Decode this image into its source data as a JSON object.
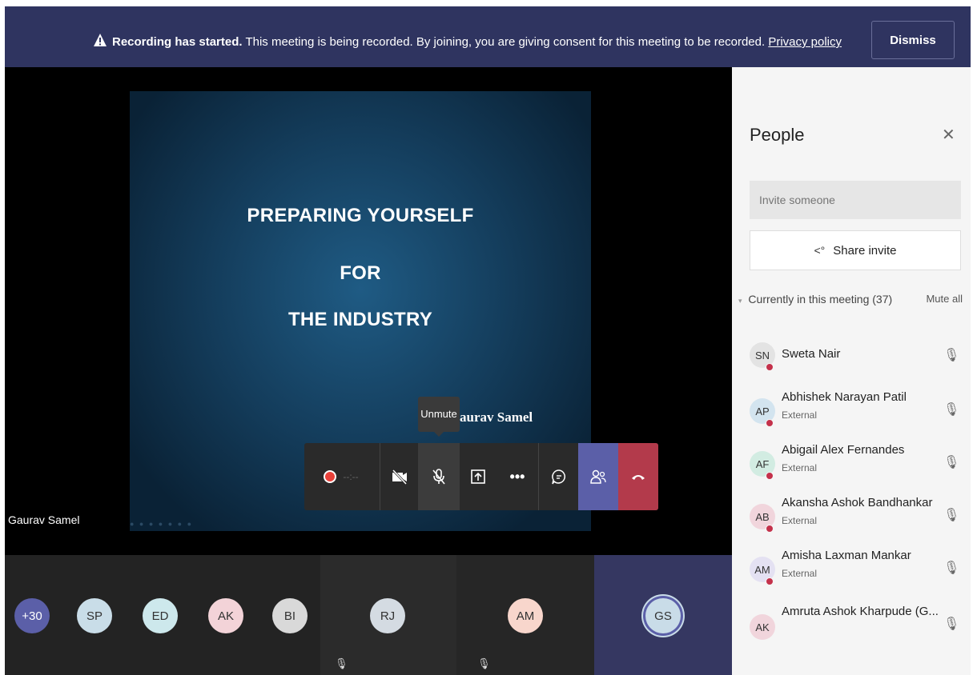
{
  "banner": {
    "title": "Recording has started.",
    "message": " This meeting is being recorded. By joining, you are giving consent for this meeting to be recorded. ",
    "link": "Privacy policy",
    "dismiss_label": "Dismiss"
  },
  "slide": {
    "line1": "PREPARING YOURSELF",
    "line2": "FOR",
    "line3": "THE INDUSTRY",
    "author": "aurav Samel"
  },
  "presenter_name": "Gaurav Samel",
  "tooltip": "Unmute",
  "controls": {
    "timer": "--:--"
  },
  "thumbnails": [
    {
      "initials": "+30"
    },
    {
      "initials": "SP"
    },
    {
      "initials": "ED"
    },
    {
      "initials": "AK"
    },
    {
      "initials": "BI"
    },
    {
      "initials": "RJ"
    },
    {
      "initials": "AM"
    },
    {
      "initials": "GS"
    }
  ],
  "panel": {
    "title": "People",
    "invite_placeholder": "Invite someone",
    "share_label": "Share invite",
    "section_label": "Currently in this meeting (37)",
    "mute_all": "Mute all",
    "people": [
      {
        "initials": "SN",
        "name": "Sweta Nair",
        "sub": ""
      },
      {
        "initials": "AP",
        "name": "Abhishek Narayan Patil",
        "sub": "External"
      },
      {
        "initials": "AF",
        "name": "Abigail Alex Fernandes",
        "sub": "External"
      },
      {
        "initials": "AB",
        "name": "Akansha Ashok Bandhankar",
        "sub": "External"
      },
      {
        "initials": "AM",
        "name": "Amisha Laxman Mankar",
        "sub": "External"
      },
      {
        "initials": "AK",
        "name": "Amruta Ashok Kharpude (G...",
        "sub": ""
      }
    ]
  },
  "colors": {
    "banner": "#2f3460",
    "accent": "#5b5fa8",
    "hangup": "#b33a4b",
    "status_busy": "#c4314b"
  }
}
